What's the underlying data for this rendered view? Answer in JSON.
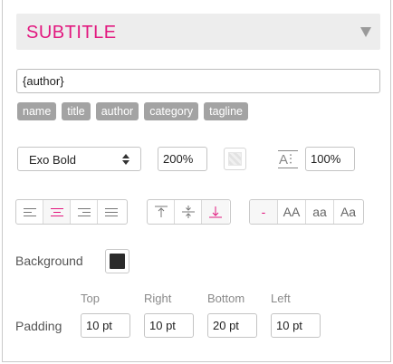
{
  "section": {
    "title": "SUBTITLE"
  },
  "text_field": {
    "value": "{author}"
  },
  "tags": [
    "name",
    "title",
    "author",
    "category",
    "tagline"
  ],
  "font": {
    "selected": "Exo Bold",
    "size": "200%",
    "line_height": "100%"
  },
  "text_align": [
    "left",
    "center",
    "right",
    "justify"
  ],
  "text_align_selected": "center",
  "vertical_align": [
    "top",
    "middle",
    "bottom"
  ],
  "vertical_align_selected": "bottom",
  "text_case": {
    "options": [
      "-",
      "AA",
      "aa",
      "Aa"
    ],
    "selected": "-"
  },
  "background": {
    "label": "Background",
    "color": "#2b2b2b"
  },
  "padding": {
    "label": "Padding",
    "columns": [
      "Top",
      "Right",
      "Bottom",
      "Left"
    ],
    "values": [
      "10 pt",
      "10 pt",
      "20 pt",
      "10 pt"
    ]
  },
  "colors": {
    "accent": "#e2187f",
    "tag_bg": "#a3a3a3",
    "header_bg": "#ededed"
  }
}
